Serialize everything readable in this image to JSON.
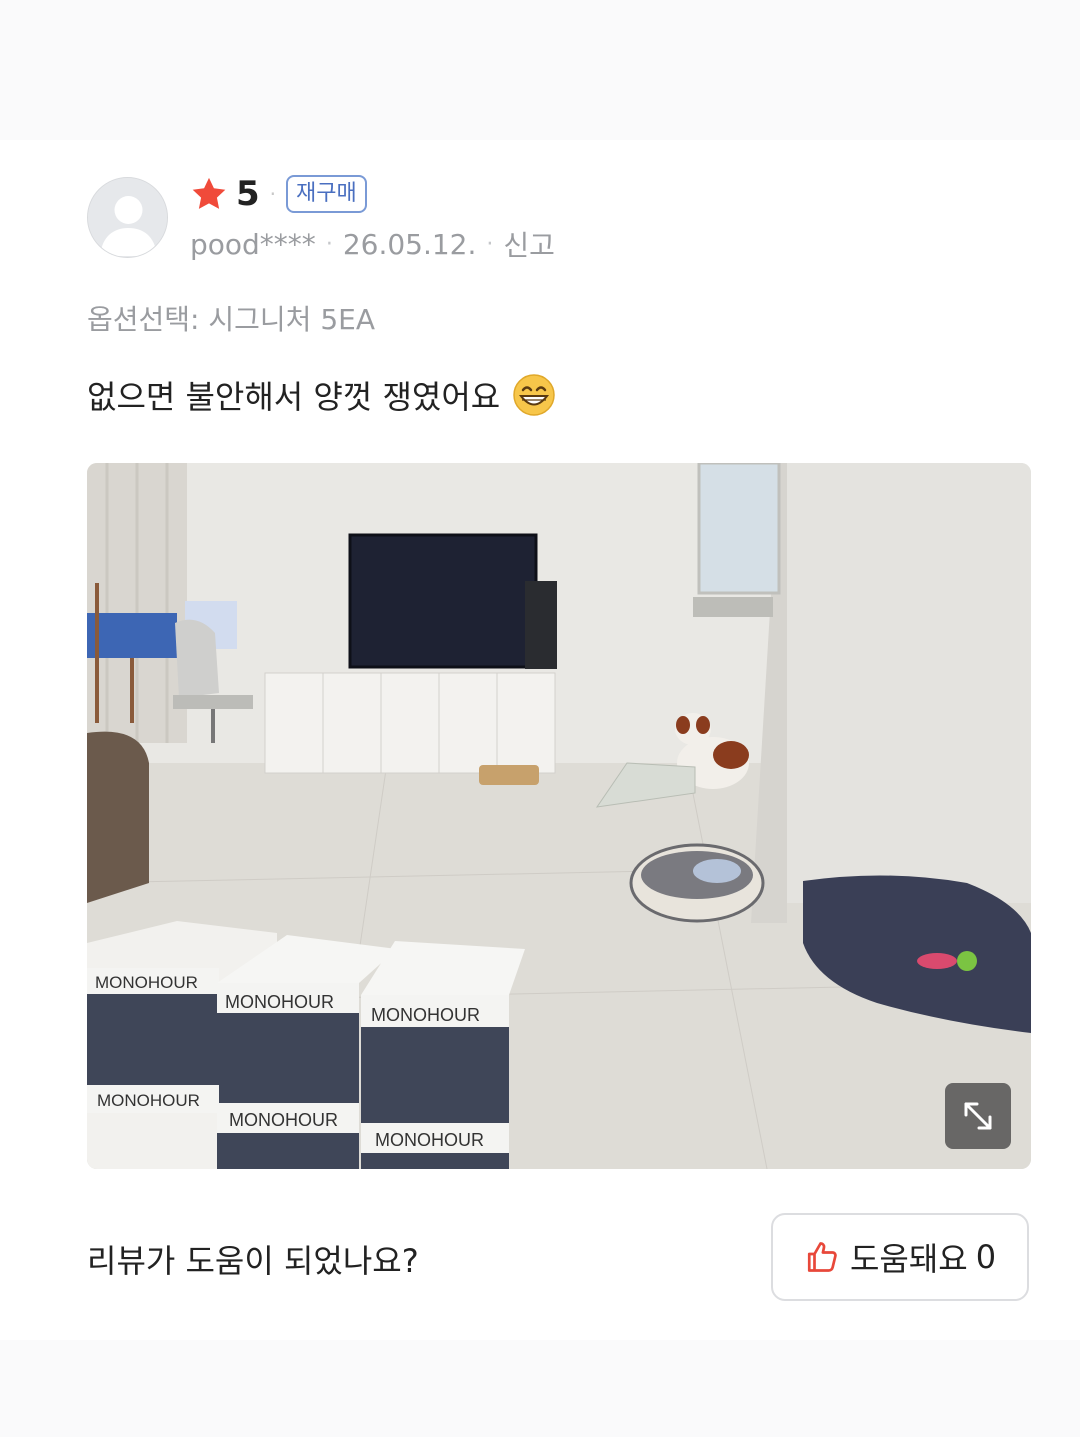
{
  "review": {
    "rating": "5",
    "badge": "재구매",
    "author": "pood****",
    "date": "26.05.12.",
    "report": "신고",
    "option": "옵션선택: 시그니처 5EA",
    "content": "없으면 불안해서 양껏 쟁였어요",
    "content_emoji": "grinning-face-icon"
  },
  "photo": {
    "box_brand": "MONOHOUR"
  },
  "helpful": {
    "question": "리뷰가 도움이 되었나요?",
    "button_label": "도움돼요",
    "count": "0"
  },
  "colors": {
    "star": "#f04a3a",
    "badge_border": "#7a9ad6",
    "badge_text": "#4a6fc0",
    "thumb_icon": "#e8483a"
  }
}
